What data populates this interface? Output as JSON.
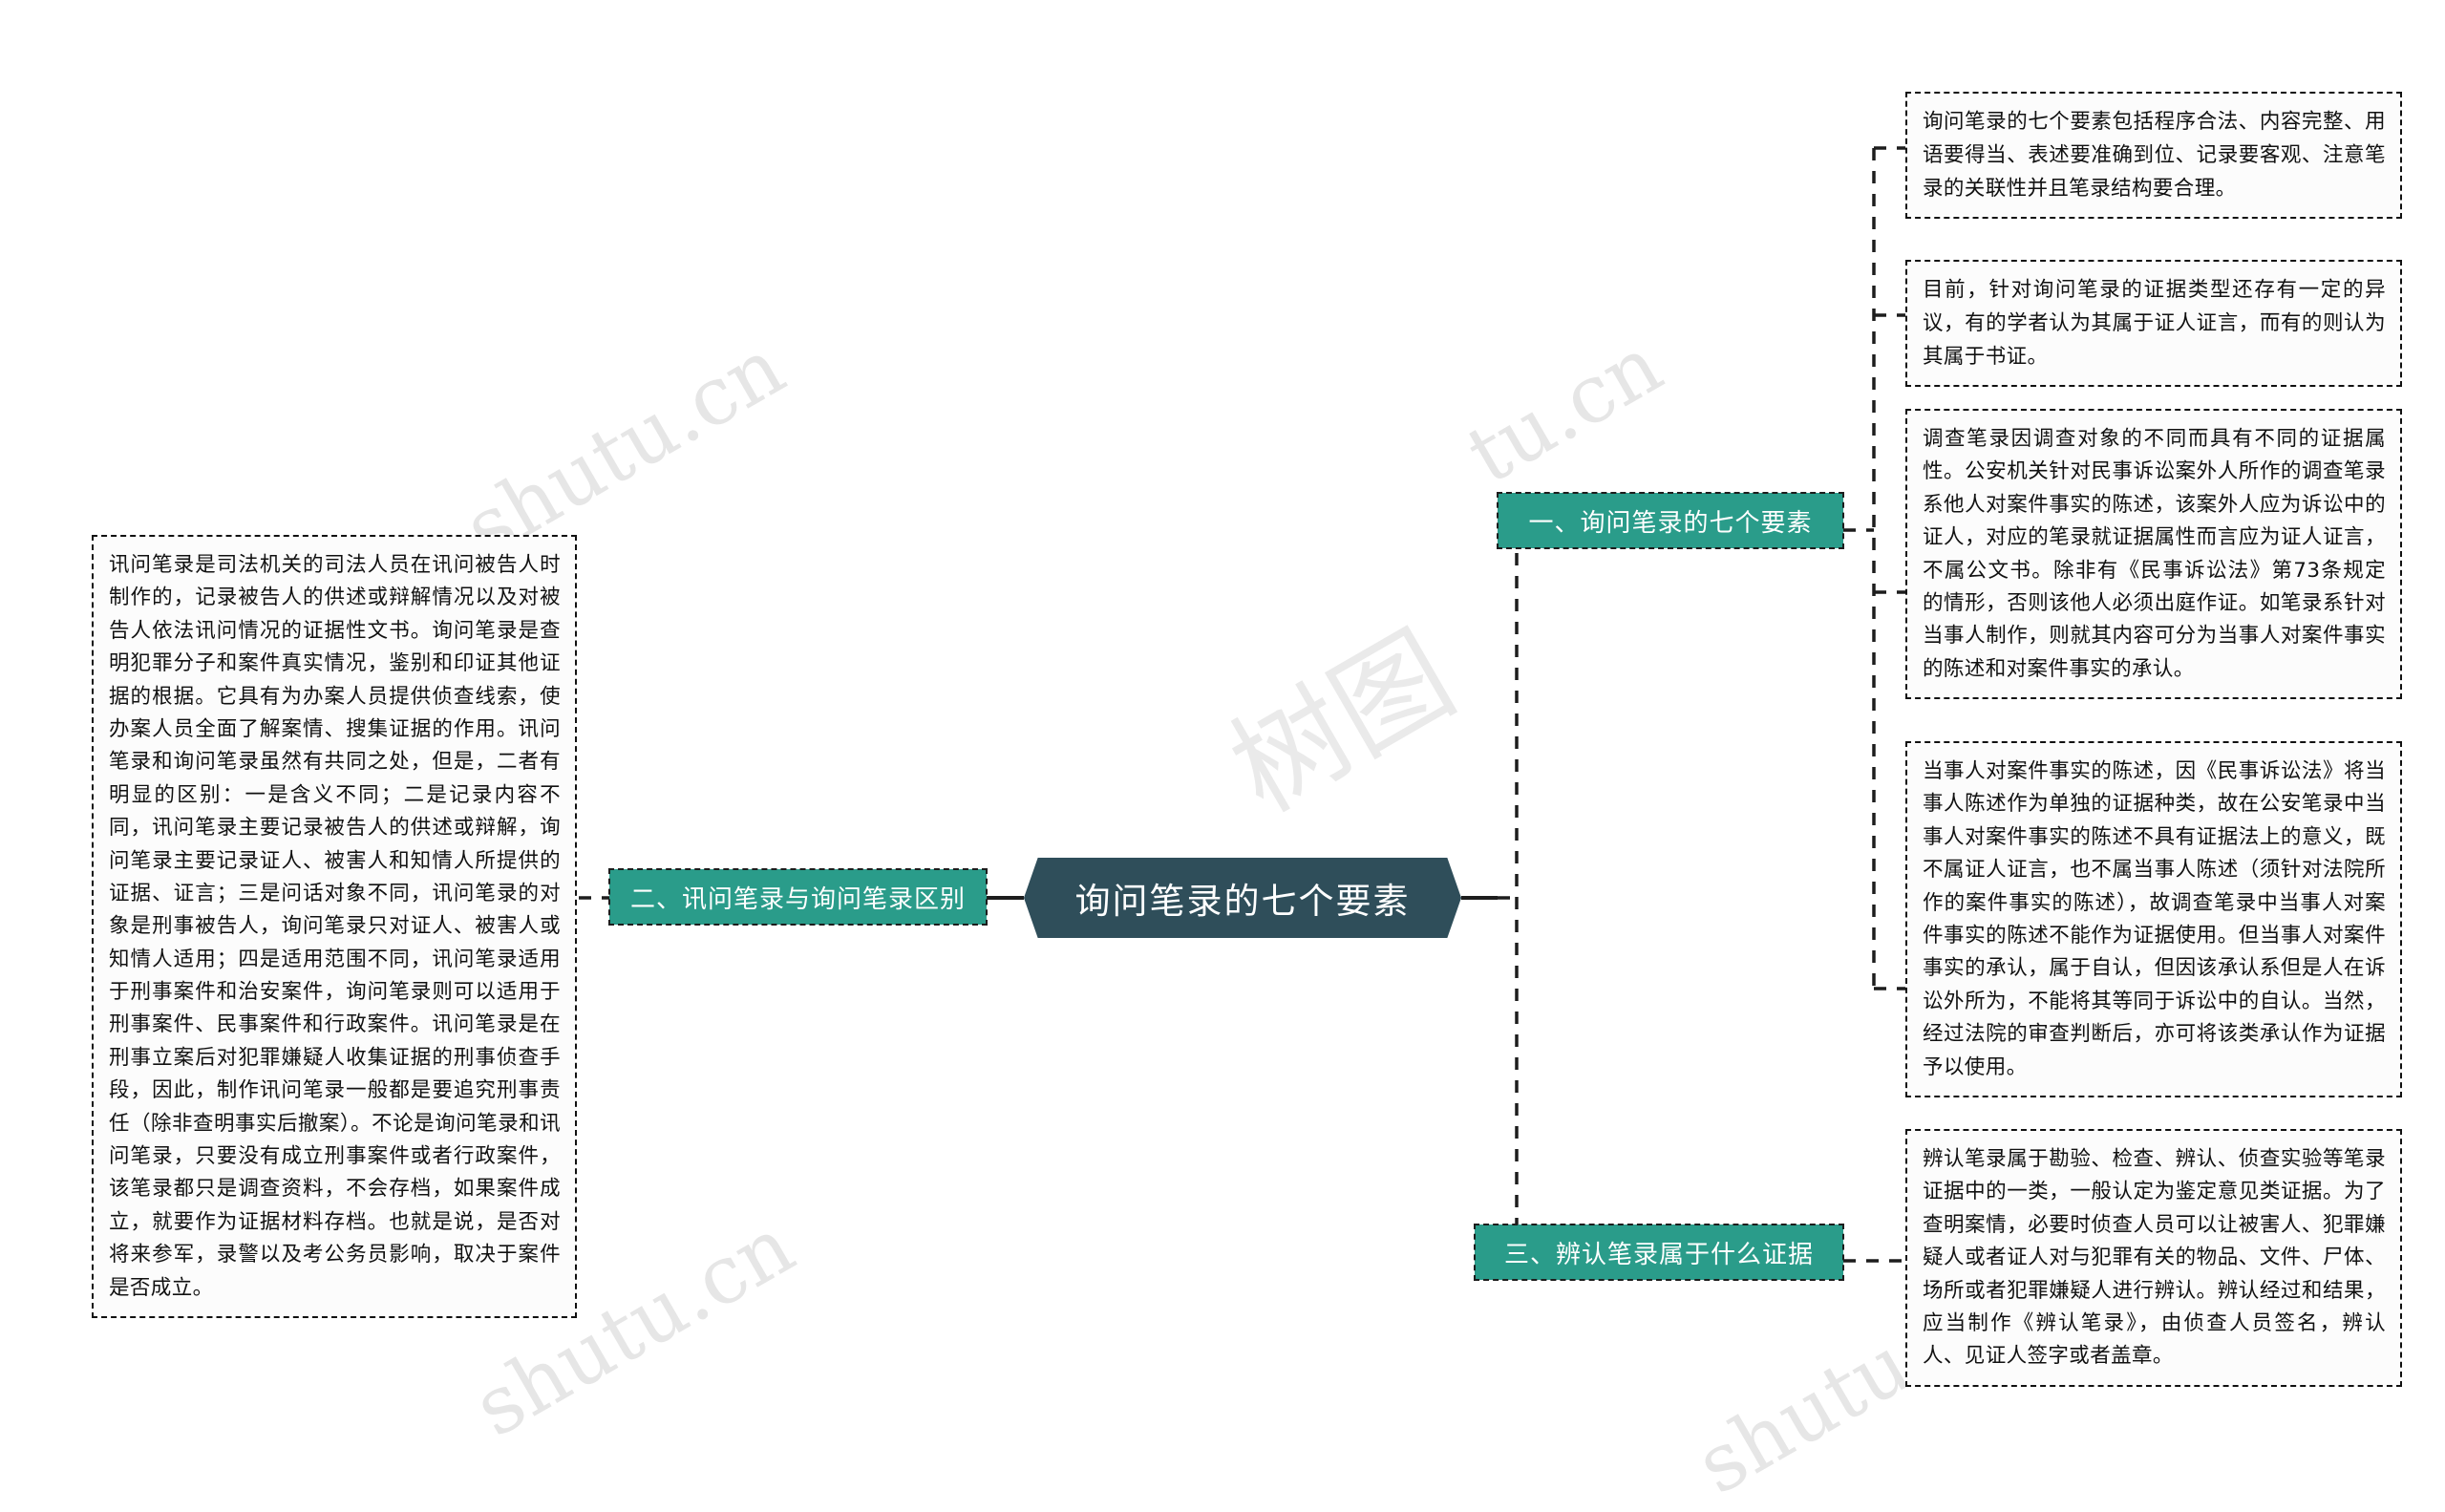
{
  "title": "询问笔录的七个要素 - 思维导图",
  "central": {
    "label": "询问笔录的七个要素"
  },
  "colors": {
    "central_fill": "#2F4E5A",
    "branch_fill": "#2A9C8A",
    "leaf_border": "#111111",
    "leaf_fill": "#FCFCFC",
    "text_light": "#FFFFFF",
    "text_dark": "#111111",
    "watermark": "#E6E6E6"
  },
  "watermarks": {
    "a": "shutu.cn",
    "b": "tu.cn",
    "c": "shutu.cn",
    "d": "shutu.cn",
    "e": "树图"
  },
  "branches": [
    {
      "id": "branch-1",
      "label": "一、询问笔录的七个要素",
      "side": "right",
      "leaves": [
        {
          "id": "leaf-1-1",
          "text": "询问笔录的七个要素包括程序合法、内容完整、用语要得当、表述要准确到位、记录要客观、注意笔录的关联性并且笔录结构要合理。"
        },
        {
          "id": "leaf-1-2",
          "text": "目前，针对询问笔录的证据类型还存有一定的异议，有的学者认为其属于证人证言，而有的则认为其属于书证。"
        },
        {
          "id": "leaf-1-3",
          "text": "调查笔录因调查对象的不同而具有不同的证据属性。公安机关针对民事诉讼案外人所作的调查笔录系他人对案件事实的陈述，该案外人应为诉讼中的证人，对应的笔录就证据属性而言应为证人证言，不属公文书。除非有《民事诉讼法》第73条规定的情形，否则该他人必须出庭作证。如笔录系针对当事人制作，则就其内容可分为当事人对案件事实的陈述和对案件事实的承认。"
        },
        {
          "id": "leaf-1-4",
          "text": "当事人对案件事实的陈述，因《民事诉讼法》将当事人陈述作为单独的证据种类，故在公安笔录中当事人对案件事实的陈述不具有证据法上的意义，既不属证人证言，也不属当事人陈述（须针对法院所作的案件事实的陈述），故调查笔录中当事人对案件事实的陈述不能作为证据使用。但当事人对案件事实的承认，属于自认，但因该承认系但是人在诉讼外所为，不能将其等同于诉讼中的自认。当然，经过法院的审查判断后，亦可将该类承认作为证据予以使用。"
        }
      ]
    },
    {
      "id": "branch-2",
      "label": "二、讯问笔录与询问笔录区别",
      "side": "left",
      "leaves": [
        {
          "id": "leaf-2-1",
          "text": "讯问笔录是司法机关的司法人员在讯问被告人时制作的，记录被告人的供述或辩解情况以及对被告人依法讯问情况的证据性文书。询问笔录是查明犯罪分子和案件真实情况，鉴别和印证其他证据的根据。它具有为办案人员提供侦查线索，使办案人员全面了解案情、搜集证据的作用。讯问笔录和询问笔录虽然有共同之处，但是，二者有明显的区别：一是含义不同；二是记录内容不同，讯问笔录主要记录被告人的供述或辩解，询问笔录主要记录证人、被害人和知情人所提供的证据、证言；三是问话对象不同，讯问笔录的对象是刑事被告人，询问笔录只对证人、被害人或知情人适用；四是适用范围不同，讯问笔录适用于刑事案件和治安案件，询问笔录则可以适用于刑事案件、民事案件和行政案件。讯问笔录是在刑事立案后对犯罪嫌疑人收集证据的刑事侦查手段，因此，制作讯问笔录一般都是要追究刑事责任（除非查明事实后撤案）。不论是询问笔录和讯问笔录，只要没有成立刑事案件或者行政案件，该笔录都只是调查资料，不会存档，如果案件成立，就要作为证据材料存档。也就是说，是否对将来参军，录警以及考公务员影响，取决于案件是否成立。"
        }
      ]
    },
    {
      "id": "branch-3",
      "label": "三、辨认笔录属于什么证据",
      "side": "right",
      "leaves": [
        {
          "id": "leaf-3-1",
          "text": "辨认笔录属于勘验、检查、辨认、侦查实验等笔录证据中的一类，一般认定为鉴定意见类证据。为了查明案情，必要时侦查人员可以让被害人、犯罪嫌疑人或者证人对与犯罪有关的物品、文件、尸体、场所或者犯罪嫌疑人进行辨认。辨认经过和结果，应当制作《辨认笔录》，由侦查人员签名，辨认人、见证人签字或者盖章。"
        }
      ]
    }
  ]
}
